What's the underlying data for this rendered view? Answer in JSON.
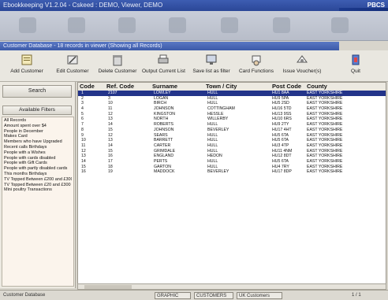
{
  "window": {
    "title": "Ebookkeeping V1.2.04 - Cskeed : DEMO, Viewer, DEMO",
    "brand": "PBCS"
  },
  "subwindow": {
    "title": "Customer Database - 18 records in viewer (Showing all Records)"
  },
  "toolbar": {
    "buttons": [
      {
        "label": "Add Customer"
      },
      {
        "label": "Edit Customer"
      },
      {
        "label": "Delete Customer"
      },
      {
        "label": "Output Current List"
      },
      {
        "label": "Save list as filter"
      },
      {
        "label": "Card Functions"
      },
      {
        "label": "Issue Voucher(s)"
      },
      {
        "label": "Quit"
      }
    ]
  },
  "leftpanel": {
    "search_label": "Search",
    "filters_label": "Available Filters",
    "filters": [
      "All Records",
      "Amount spent over $4",
      "People in December",
      "Makes Card",
      "Members who have Upgraded",
      "Recent calls Birthdays",
      "People with a Wishes",
      "People with cards disabled",
      "People with Gift Cards",
      "People with partly disabled cards",
      "This months Birthdays",
      "TV Topped Between £200 and £300",
      "TV Topped Between £20 and £300",
      "Mini poultry Transactions"
    ]
  },
  "grid": {
    "columns": [
      "Code",
      "Ref. Code",
      "Surname",
      "Town / City",
      "Post Code",
      "County"
    ],
    "rows": [
      {
        "code": "1",
        "ref": "2107",
        "surname": "LOWLEY",
        "town": "HULL",
        "post": "HU1 8AA",
        "county": "EAST YORKSHIRE"
      },
      {
        "code": "2",
        "ref": "3",
        "surname": "LOGAN",
        "town": "HULL",
        "post": "HU9 5PA",
        "county": "EAST YORKSHIRE"
      },
      {
        "code": "3",
        "ref": "10",
        "surname": "BIRCH",
        "town": "HULL",
        "post": "HU5 2SD",
        "county": "EAST YORKSHIRE"
      },
      {
        "code": "4",
        "ref": "11",
        "surname": "JOHNSON",
        "town": "COTTINGHAM",
        "post": "HU16 5TD",
        "county": "EAST YORKSHIRE"
      },
      {
        "code": "5",
        "ref": "12",
        "surname": "KINGSTON",
        "town": "HESSLE",
        "post": "HU13 9SS",
        "county": "EAST YORKSHIRE"
      },
      {
        "code": "6",
        "ref": "13",
        "surname": "NORTH",
        "town": "WILLERBY",
        "post": "HU10 6RS",
        "county": "EAST YORKSHIRE"
      },
      {
        "code": "7",
        "ref": "14",
        "surname": "ROBERTS",
        "town": "HULL",
        "post": "HU9 2TY",
        "county": "EAST YORKSHIRE"
      },
      {
        "code": "8",
        "ref": "15",
        "surname": "JOHNSON",
        "town": "BEVERLEY",
        "post": "HU17 4HT",
        "county": "EAST YORKSHIRE"
      },
      {
        "code": "9",
        "ref": "12",
        "surname": "SEARS",
        "town": "HULL",
        "post": "HU5 6TA",
        "county": "EAST YORKSHIRE"
      },
      {
        "code": "10",
        "ref": "13",
        "surname": "BARRETT",
        "town": "HULL",
        "post": "HU5 6TA",
        "county": "EAST YORKSHIRE"
      },
      {
        "code": "11",
        "ref": "14",
        "surname": "CARTER",
        "town": "HULL",
        "post": "HU3 4TP",
        "county": "EAST YORKSHIRE"
      },
      {
        "code": "12",
        "ref": "15",
        "surname": "GRIMDALE",
        "town": "HULL",
        "post": "HU11 4NM",
        "county": "EAST YORKSHIRE"
      },
      {
        "code": "13",
        "ref": "16",
        "surname": "ENGLAND",
        "town": "HEDON",
        "post": "HU12 8DT",
        "county": "EAST YORKSHIRE"
      },
      {
        "code": "14",
        "ref": "17",
        "surname": "PERTS",
        "town": "HULL",
        "post": "HU5 6TA",
        "county": "EAST YORKSHIRE"
      },
      {
        "code": "15",
        "ref": "18",
        "surname": "GARTON",
        "town": "HULL",
        "post": "HU4 7RY",
        "county": "EAST YORKSHIRE"
      },
      {
        "code": "16",
        "ref": "19",
        "surname": "MADDOCK",
        "town": "BEVERLEY",
        "post": "HU17 8DP",
        "county": "EAST YORKSHIRE"
      }
    ]
  },
  "statusbar": {
    "segments": [
      "Customer Database",
      "GRAPHIC",
      "CUSTOMERS",
      "UK Customers",
      "1 / 1"
    ]
  },
  "colors": {
    "selection": "#23348a",
    "titlebar": "#2b4797"
  }
}
